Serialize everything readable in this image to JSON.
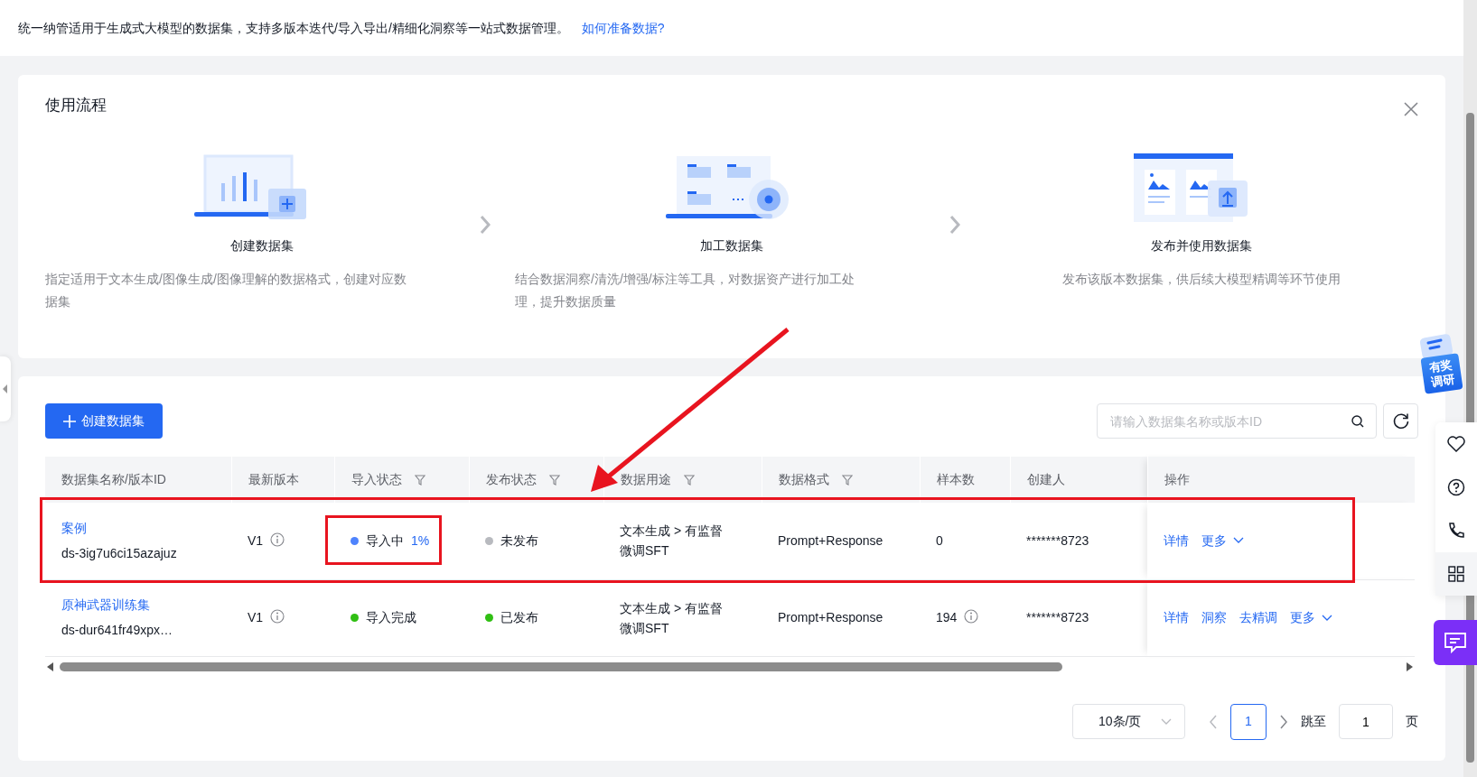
{
  "intro": {
    "text": "统一纳管适用于生成式大模型的数据集，支持多版本迭代/导入导出/精细化洞察等一站式数据管理。",
    "link": "如何准备数据?"
  },
  "workflow": {
    "title": "使用流程",
    "steps": [
      {
        "kind": "create",
        "title": "创建数据集",
        "description": "指定适用于文本生成/图像生成/图像理解的数据格式，创建对应数据集"
      },
      {
        "kind": "process",
        "title": "加工数据集",
        "description": "结合数据洞察/清洗/增强/标注等工具，对数据资产进行加工处理，提升数据质量"
      },
      {
        "kind": "publish",
        "title": "发布并使用数据集",
        "description": "发布该版本数据集，供后续大模型精调等环节使用"
      }
    ]
  },
  "toolbar": {
    "create_button": "创建数据集",
    "search": {
      "placeholder": "请输入数据集名称或版本ID"
    }
  },
  "table": {
    "columns": [
      {
        "label": "数据集名称/版本ID",
        "filter": false
      },
      {
        "label": "最新版本",
        "filter": false
      },
      {
        "label": "导入状态",
        "filter": true
      },
      {
        "label": "发布状态",
        "filter": true
      },
      {
        "label": "数据用途",
        "filter": true
      },
      {
        "label": "数据格式",
        "filter": true
      },
      {
        "label": "样本数",
        "filter": false
      },
      {
        "label": "创建人",
        "filter": false
      },
      {
        "label": "操作",
        "filter": false
      }
    ],
    "rows": [
      {
        "name": "案例",
        "id": "ds-3ig7u6ci15azajuz",
        "version": "V1",
        "import_status": {
          "label": "导入中",
          "color": "#4e83fd",
          "progress": "1%"
        },
        "publish_status": {
          "label": "未发布",
          "color": "#b8babf"
        },
        "purpose": "文本生成 > 有监督微调SFT",
        "format": "Prompt+Response",
        "samples": "0",
        "samples_info": false,
        "creator": "*******8723",
        "actions": [
          "详情"
        ],
        "more": "更多",
        "highlighted": true
      },
      {
        "name": "原神武器训练集",
        "id": "ds-dur641fr49xpx…",
        "version": "V1",
        "import_status": {
          "label": "导入完成",
          "color": "#30bf13"
        },
        "publish_status": {
          "label": "已发布",
          "color": "#30bf13"
        },
        "purpose": "文本生成 > 有监督微调SFT",
        "format": "Prompt+Response",
        "samples": "194",
        "samples_info": true,
        "creator": "*******8723",
        "actions": [
          "详情",
          "洞察",
          "去精调"
        ],
        "more": "更多",
        "highlighted": false
      }
    ]
  },
  "pagination": {
    "page_size": "10条/页",
    "pages": [
      {
        "label": "1",
        "selected": true
      }
    ],
    "jump_label": "跳至",
    "jump_value": "1",
    "page_suffix": "页"
  },
  "side": {
    "survey_badge": "有奖调研"
  }
}
